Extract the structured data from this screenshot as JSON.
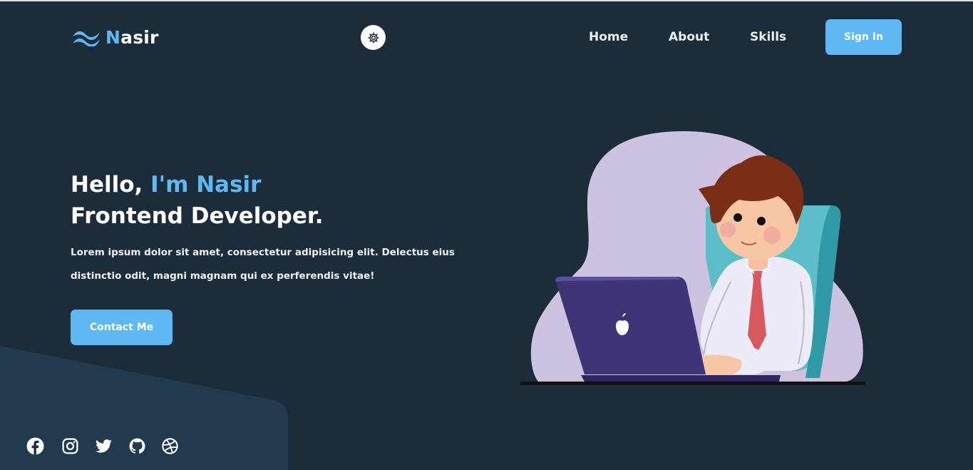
{
  "nav": {
    "logo": {
      "initial": "N",
      "rest": "asir",
      "icon": "wave-logo-icon"
    },
    "theme_toggle_icon": "gear-icon",
    "links": [
      "Home",
      "About",
      "Skills"
    ],
    "signin_label": "Sign In"
  },
  "hero": {
    "greeting": "Hello,",
    "name": "I'm Nasir",
    "role": "Frontend Developer.",
    "description": "Lorem ipsum dolor sit amet, consectetur adipisicing elit. Delectus eius distinctio odit, magni magnam qui ex perferendis vitae!",
    "cta_label": "Contact Me",
    "illustration": "developer-with-laptop-illustration"
  },
  "socials": [
    "facebook-icon",
    "instagram-icon",
    "twitter-icon",
    "github-icon",
    "dribbble-icon"
  ],
  "colors": {
    "background": "#1b2c3b",
    "accent": "#60b8f2",
    "text": "#ffffff",
    "shape": "#213a4e"
  }
}
